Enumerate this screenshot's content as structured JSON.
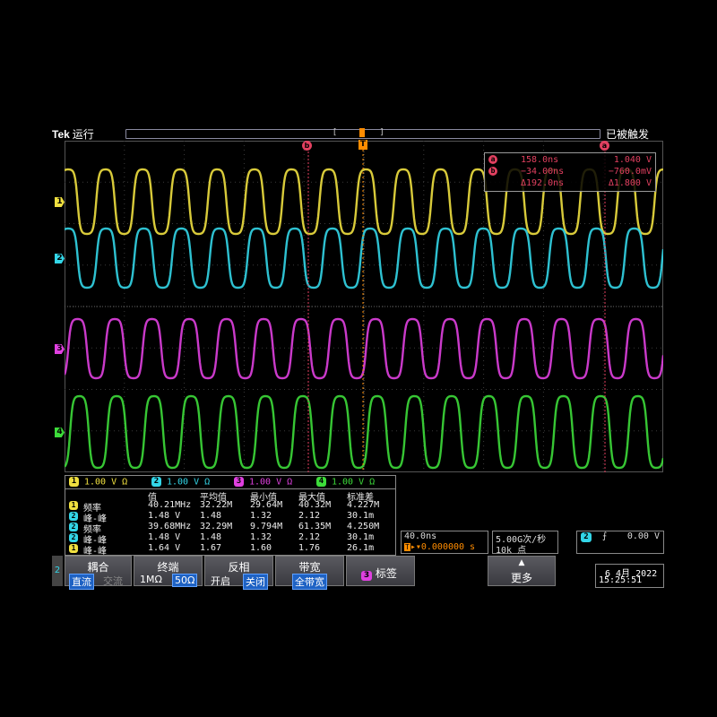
{
  "header": {
    "brand": "Tek",
    "run_state": "运行",
    "trigger_state": "已被触发"
  },
  "markers": {
    "cursor_b": "b",
    "trigger": "T",
    "cursor_a": "a"
  },
  "cursor_readout": {
    "rows": [
      {
        "badge": "a",
        "time": "158.0ns",
        "volt": "1.040 V"
      },
      {
        "badge": "b",
        "time": "−34.00ns",
        "volt": "−760.0mV"
      },
      {
        "badge": "",
        "time": "Δ192.0ns",
        "volt": "Δ1.800 V"
      }
    ]
  },
  "channels": [
    {
      "num": "1",
      "color": "#f0e040",
      "scale": "1.00 V",
      "unit": "Ω",
      "freq_mhz": 40.21,
      "amplitude": 1.64
    },
    {
      "num": "2",
      "color": "#33d6e8",
      "scale": "1.00 V",
      "unit": "Ω",
      "freq_mhz": 39.68,
      "amplitude": 1.48
    },
    {
      "num": "3",
      "color": "#e040e0",
      "scale": "1.00 V",
      "unit": "Ω",
      "freq_mhz": 40.21,
      "amplitude": 1.48
    },
    {
      "num": "4",
      "color": "#3ddc3a",
      "scale": "1.00 V",
      "unit": "Ω",
      "freq_mhz": 40.21,
      "amplitude": 1.48
    }
  ],
  "measurements": {
    "headers": [
      "值",
      "平均值",
      "最小值",
      "最大值",
      "标准差"
    ],
    "rows": [
      {
        "ch": "1",
        "color": "#f0e040",
        "name": "频率",
        "value": "40.21MHz",
        "mean": "32.22M",
        "min": "29.64M",
        "max": "40.32M",
        "std": "4.227M"
      },
      {
        "ch": "2",
        "color": "#33d6e8",
        "name": "峰-峰",
        "value": "1.48 V",
        "mean": "1.48",
        "min": "1.32",
        "max": "2.12",
        "std": "30.1m"
      },
      {
        "ch": "2",
        "color": "#33d6e8",
        "name": "频率",
        "value": "39.68MHz",
        "mean": "32.29M",
        "min": "9.794M",
        "max": "61.35M",
        "std": "4.250M"
      },
      {
        "ch": "2",
        "color": "#33d6e8",
        "name": "峰-峰",
        "value": "1.48 V",
        "mean": "1.48",
        "min": "1.32",
        "max": "2.12",
        "std": "30.1m"
      },
      {
        "ch": "1",
        "color": "#f0e040",
        "name": "峰-峰",
        "value": "1.64 V",
        "mean": "1.67",
        "min": "1.60",
        "max": "1.76",
        "std": "26.1m"
      }
    ]
  },
  "horizontal": {
    "scale": "40.0ns",
    "position": "0.000000 s"
  },
  "acquisition": {
    "rate": "5.00G次/秒",
    "points": "10k 点"
  },
  "trigger": {
    "channel": "2",
    "slope": "⨍",
    "level": "0.00 V"
  },
  "menu": {
    "side_channel": "2",
    "coupling": {
      "title": "耦合",
      "options": [
        "直流",
        "交流"
      ],
      "selected": "直流"
    },
    "termination": {
      "title": "终端",
      "options": [
        "1MΩ",
        "50Ω"
      ],
      "selected": "50Ω"
    },
    "invert": {
      "title": "反相",
      "options": [
        "开启",
        "关闭"
      ],
      "selected": "关闭"
    },
    "bandwidth": {
      "title": "带宽",
      "value": "全带宽"
    },
    "label": {
      "badge": "3",
      "title": "标签"
    },
    "more": {
      "title": "更多"
    }
  },
  "datetime": {
    "date": "6 4月 2022",
    "time": "15:25:51"
  }
}
